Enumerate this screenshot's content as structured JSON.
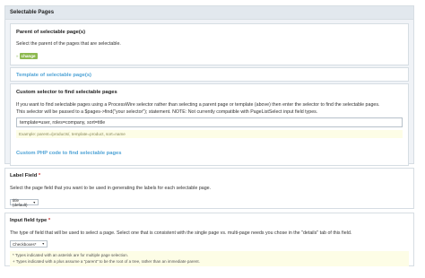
{
  "selectable_pages": {
    "title": "Selectable Pages",
    "parent": {
      "title": "Parent of selectable page(s)",
      "description": "Select the parent of the pages that are selectable.",
      "arrow": "»",
      "change_label": "change"
    },
    "template_title": "Template of selectable page(s)",
    "custom_selector": {
      "title": "Custom selector to find selectable pages",
      "description_line1": "If you want to find selectable pages using a ProcessWire selector rather than selecting a parent page or template (above) then enter the selector to find the selectable pages.",
      "description_line2": "This selector will be passed to a $pages->find(\"your selector\"); statement. NOTE: Not currently compatible with PageListSelect input field types.",
      "value": "template=user, roles=company, sort=title",
      "example": "Example: parent=/products/, template=product, sort=name"
    },
    "custom_php_title": "Custom PHP code to find selectable pages"
  },
  "label_field": {
    "title": "Label Field",
    "required_mark": "*",
    "description": "Select the page field that you want to be used in generating the labels for each selectable page.",
    "selected": "title (default)"
  },
  "input_field_type": {
    "title": "Input field type",
    "required_mark": "*",
    "description": "The type of field that will be used to select a page. Select one that is consistent with the single page vs. multi-page needs you chose in the \"details\" tab of this field.",
    "selected": "Checkboxes*",
    "note1": "* Types indicated with an asterisk are for multiple page selection.",
    "note2": "+ Types indicated with a plus assume a \"parent\" to be the root of a tree, rather than an immediate parent."
  },
  "icons": {
    "dropdown": "chevron-down-icon",
    "arrow": "double-arrow-icon"
  },
  "colors": {
    "accent": "#8db94f",
    "link": "#4fa3d6",
    "required": "#cc3333",
    "notes_bg": "#fdfde6"
  }
}
